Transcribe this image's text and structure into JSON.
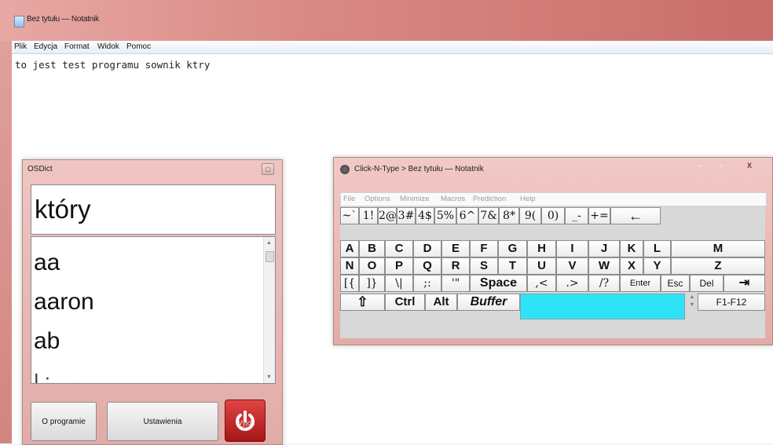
{
  "notepad": {
    "title": "Bez tytułu — Notatnik",
    "menu": [
      "Plik",
      "Edycja",
      "Format",
      "Widok",
      "Pomoc"
    ],
    "content": "to jest test programu sownik ktry"
  },
  "osdict": {
    "title": "OSDict",
    "close_glyph": "▢",
    "current_word": "który",
    "suggestions": [
      "aa",
      "aaron",
      "ab"
    ],
    "about_button": "O programie",
    "settings_button": "Ustawienia",
    "power_label": "Wyjdź"
  },
  "clickntype": {
    "title": "Click-N-Type > Bez tytułu — Notatnik",
    "controls": [
      "–",
      "▫",
      "X"
    ],
    "menu": [
      "File",
      "Options",
      "Minimize",
      "Macros",
      "Prediction",
      "Help"
    ],
    "row1": [
      "~`",
      "1!",
      "2@",
      "3#",
      "4$",
      "5%",
      "6^",
      "7&",
      "8*",
      "9(",
      "0)",
      "_-",
      "+=",
      "←"
    ],
    "row2": [
      "A",
      "B",
      "C",
      "D",
      "E",
      "F",
      "G",
      "H",
      "I",
      "J",
      "K",
      "L",
      "M"
    ],
    "row3": [
      "N",
      "O",
      "P",
      "Q",
      "R",
      "S",
      "T",
      "U",
      "V",
      "W",
      "X",
      "Y",
      "Z"
    ],
    "row4": [
      "[{",
      "]}",
      "\\|",
      ";:",
      "'\"",
      "Space",
      ",<",
      ".>",
      "/?",
      "Enter",
      "Esc",
      "Del",
      "⇥"
    ],
    "row5": {
      "shift": "⇧",
      "ctrl": "Ctrl",
      "alt": "Alt",
      "buffer": "Buffer",
      "fkeys": "F1-F12"
    }
  },
  "colors": {
    "titlebar_accent": "#d98984",
    "buffer_field": "#2fe3f6",
    "power_button": "#c42020"
  }
}
